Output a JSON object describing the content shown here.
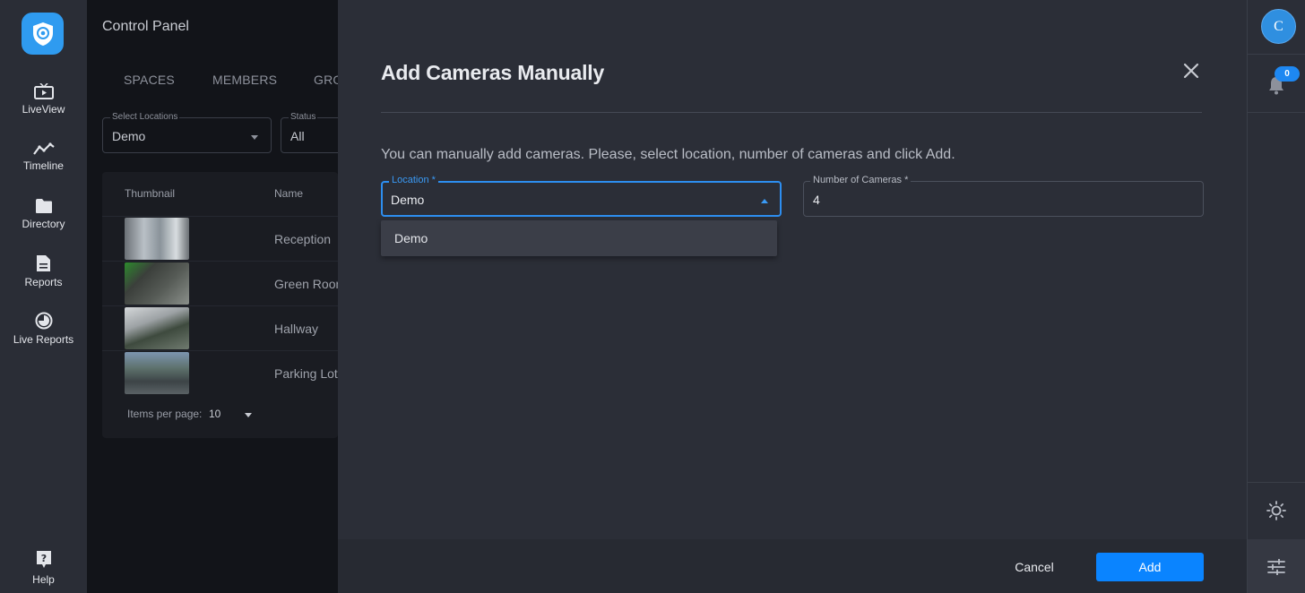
{
  "nav": {
    "items": [
      {
        "label": "LiveView",
        "icon": "tv-icon"
      },
      {
        "label": "Timeline",
        "icon": "timeline-icon"
      },
      {
        "label": "Directory",
        "icon": "folder-icon"
      },
      {
        "label": "Reports",
        "icon": "document-icon"
      },
      {
        "label": "Live Reports",
        "icon": "pie-icon"
      }
    ],
    "help_label": "Help"
  },
  "page": {
    "title": "Control Panel",
    "tabs": [
      "SPACES",
      "MEMBERS",
      "GRO"
    ],
    "filters": {
      "location_label": "Select Locations",
      "location_value": "Demo",
      "status_label": "Status",
      "status_value": "All"
    },
    "table": {
      "headers": [
        "Thumbnail",
        "Name"
      ],
      "rows": [
        "Reception",
        "Green Room",
        "Hallway",
        "Parking Lot"
      ]
    },
    "items_per_page_label": "Items per page:",
    "items_per_page_value": "10"
  },
  "dialog": {
    "title": "Add Cameras Manually",
    "description": "You can manually add cameras. Please, select location, number of cameras and click Add.",
    "location_label": "Location *",
    "location_value": "Demo",
    "number_label": "Number of Cameras *",
    "number_value": "4",
    "dropdown_options": [
      "Demo"
    ],
    "cancel_label": "Cancel",
    "add_label": "Add"
  },
  "rail": {
    "avatar_letter": "C",
    "notification_count": "0"
  },
  "colors": {
    "accent": "#0a84ff",
    "focus": "#2d8ef0",
    "dialog_bg": "#2b2e37",
    "nav_bg": "#2a2d36"
  }
}
